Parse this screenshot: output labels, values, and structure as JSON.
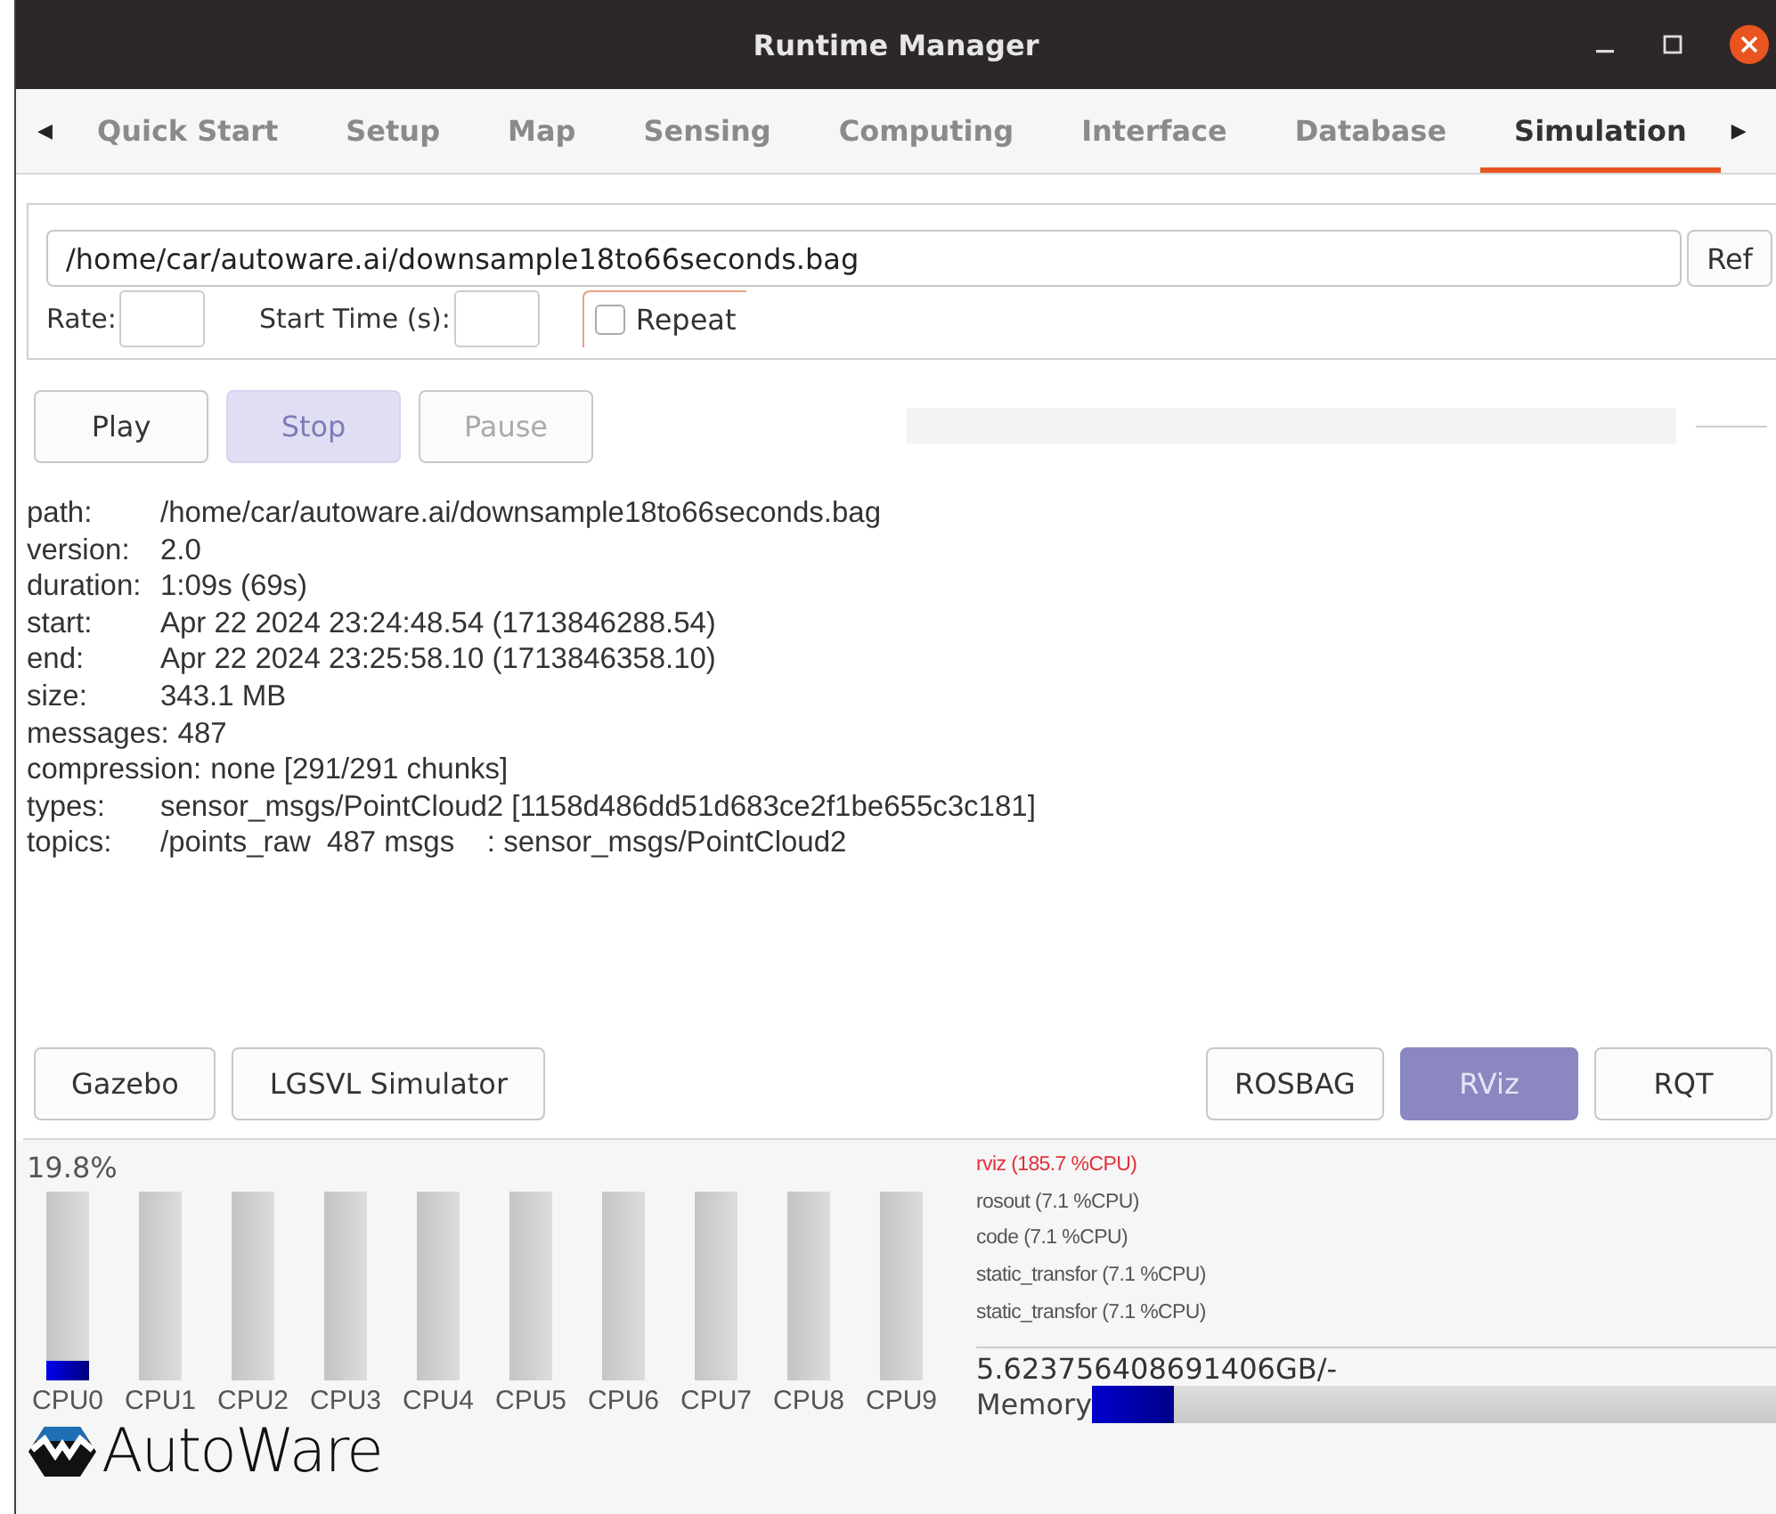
{
  "window": {
    "title": "Runtime Manager"
  },
  "tabs_nav": {
    "left": "◀",
    "right": "▶"
  },
  "tabs": [
    {
      "label": "Quick Start",
      "selected": false
    },
    {
      "label": "Setup",
      "selected": false
    },
    {
      "label": "Map",
      "selected": false
    },
    {
      "label": "Sensing",
      "selected": false
    },
    {
      "label": "Computing",
      "selected": false
    },
    {
      "label": "Interface",
      "selected": false
    },
    {
      "label": "Database",
      "selected": false
    },
    {
      "label": "Simulation",
      "selected": true
    }
  ],
  "file": {
    "path": "/home/car/autoware.ai/downsample18to66seconds.bag",
    "ref_button": "Ref",
    "rate_label": "Rate:",
    "start_label": "Start Time (s):",
    "repeat": {
      "label": "Repeat",
      "checked": false
    }
  },
  "playback_buttons": [
    {
      "label": "Play",
      "disabled": false,
      "active": false
    },
    {
      "label": "Stop",
      "disabled": true,
      "active": true
    },
    {
      "label": "Pause",
      "disabled": true,
      "active": false
    }
  ],
  "progress": {
    "level": 0
  },
  "info": [
    {
      "label": "path:",
      "value": "/home/car/autoware.ai/downsample18to66seconds.bag"
    },
    {
      "label": "version:",
      "value": "2.0"
    },
    {
      "label": "duration:",
      "value": "1:09s (69s)"
    },
    {
      "label": "start:",
      "value": "Apr 22 2024 23:24:48.54 (1713846288.54)"
    },
    {
      "label": "end:",
      "value": "Apr 22 2024 23:25:58.10 (1713846358.10)"
    },
    {
      "label": "size:",
      "value": "343.1 MB"
    },
    {
      "label": "messages:",
      "value": "487"
    },
    {
      "label": "compression:",
      "value": "none [291/291 chunks]"
    },
    {
      "label": "types:",
      "value": "sensor_msgs/PointCloud2 [1158d486dd51d683ce2f1be655c3c181]"
    },
    {
      "label": "topics:",
      "value": "/points_raw  487 msgs    : sensor_msgs/PointCloud2"
    }
  ],
  "left_tools": [
    {
      "label": "Gazebo",
      "active": false
    },
    {
      "label": "LGSVL Simulator",
      "active": false
    }
  ],
  "right_tools": [
    {
      "label": "ROSBAG",
      "active": false
    },
    {
      "label": "RViz",
      "active": true
    },
    {
      "label": "RQT",
      "active": false
    }
  ],
  "cpu": {
    "total": "19.8%",
    "cores": [
      {
        "name": "CPU0",
        "level": 0.1
      },
      {
        "name": "CPU1",
        "level": 0
      },
      {
        "name": "CPU2",
        "level": 0
      },
      {
        "name": "CPU3",
        "level": 0
      },
      {
        "name": "CPU4",
        "level": 0
      },
      {
        "name": "CPU5",
        "level": 0
      },
      {
        "name": "CPU6",
        "level": 0
      },
      {
        "name": "CPU7",
        "level": 0
      },
      {
        "name": "CPU8",
        "level": 0
      },
      {
        "name": "CPU9",
        "level": 0
      }
    ]
  },
  "processes": [
    {
      "text": "rviz (185.7 %CPU)",
      "color": "#e0303a"
    },
    {
      "text": "rosout (7.1 %CPU)",
      "color": "#555555"
    },
    {
      "text": "code (7.1 %CPU)",
      "color": "#555555"
    },
    {
      "text": "static_transfor (7.1 %CPU)",
      "color": "#555555"
    },
    {
      "text": "static_transfor (7.1 %CPU)",
      "color": "#555555"
    }
  ],
  "memory": {
    "usage": "5.623756408691406GB/-",
    "label": "Memory",
    "level": 0.12
  },
  "logo": {
    "text": "AutoWare"
  }
}
